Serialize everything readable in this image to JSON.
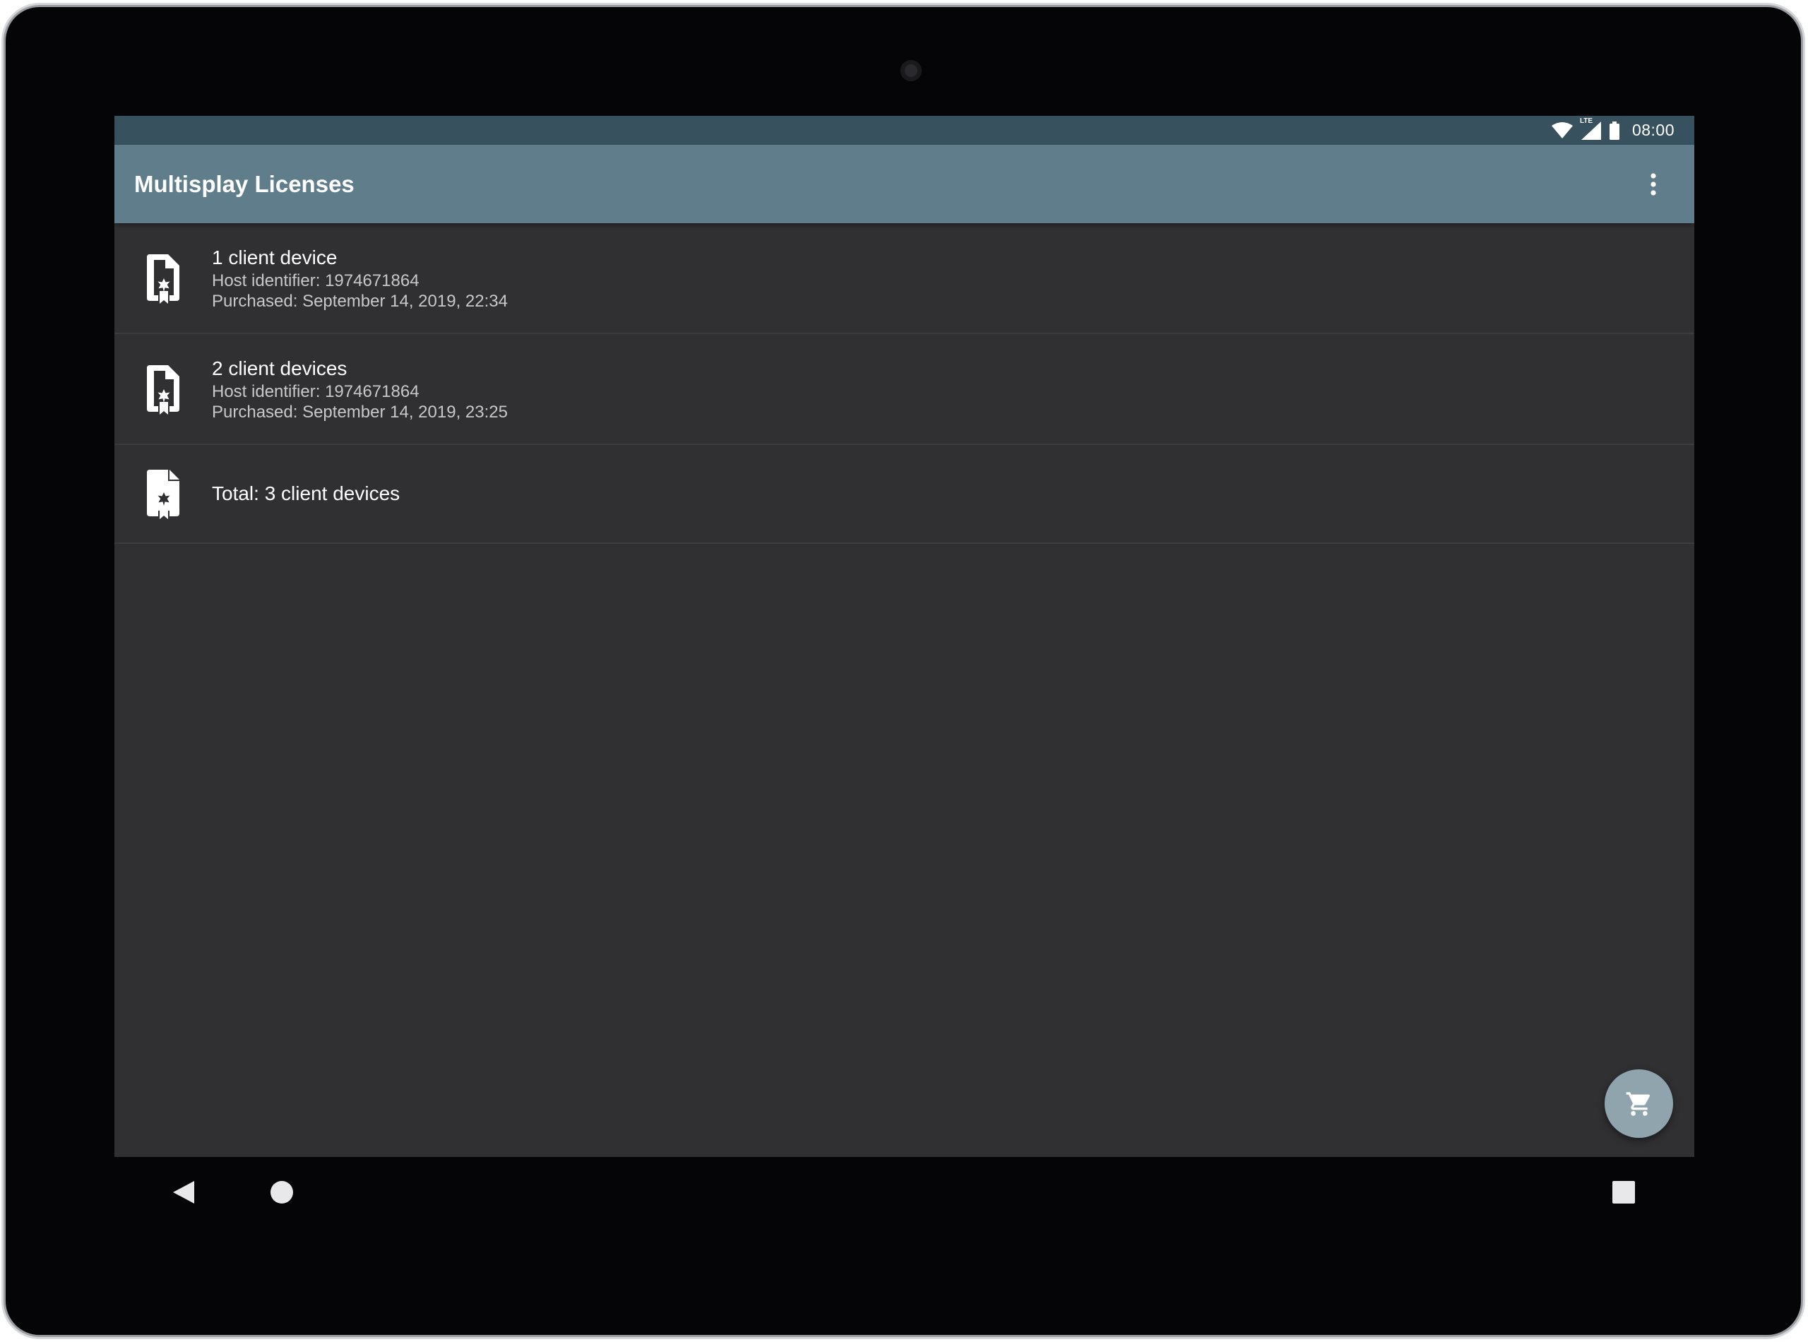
{
  "status_bar": {
    "time": "08:00",
    "icons": [
      "wifi-icon",
      "lte-signal-icon",
      "battery-icon"
    ],
    "network_label": "LTE"
  },
  "app_bar": {
    "title": "Multisplay Licenses",
    "overflow_icon": "more-vert-icon"
  },
  "licenses": [
    {
      "icon": "license-certificate-icon",
      "title": "1 client device",
      "host": "Host identifier: 1974671864",
      "purchased": "Purchased: September 14, 2019, 22:34"
    },
    {
      "icon": "license-certificate-icon",
      "title": "2 client devices",
      "host": "Host identifier: 1974671864",
      "purchased": "Purchased: September 14, 2019, 23:25"
    }
  ],
  "total": {
    "icon": "license-certificate-icon",
    "text": "Total: 3 client devices"
  },
  "fab": {
    "icon": "shopping-cart-icon"
  },
  "nav_bar": {
    "icons": [
      "back-icon",
      "home-icon",
      "recents-icon"
    ]
  },
  "colors": {
    "status_bar": "#37515f",
    "app_bar": "#607d8b",
    "background": "#303033",
    "fab": "#90a4ae"
  }
}
